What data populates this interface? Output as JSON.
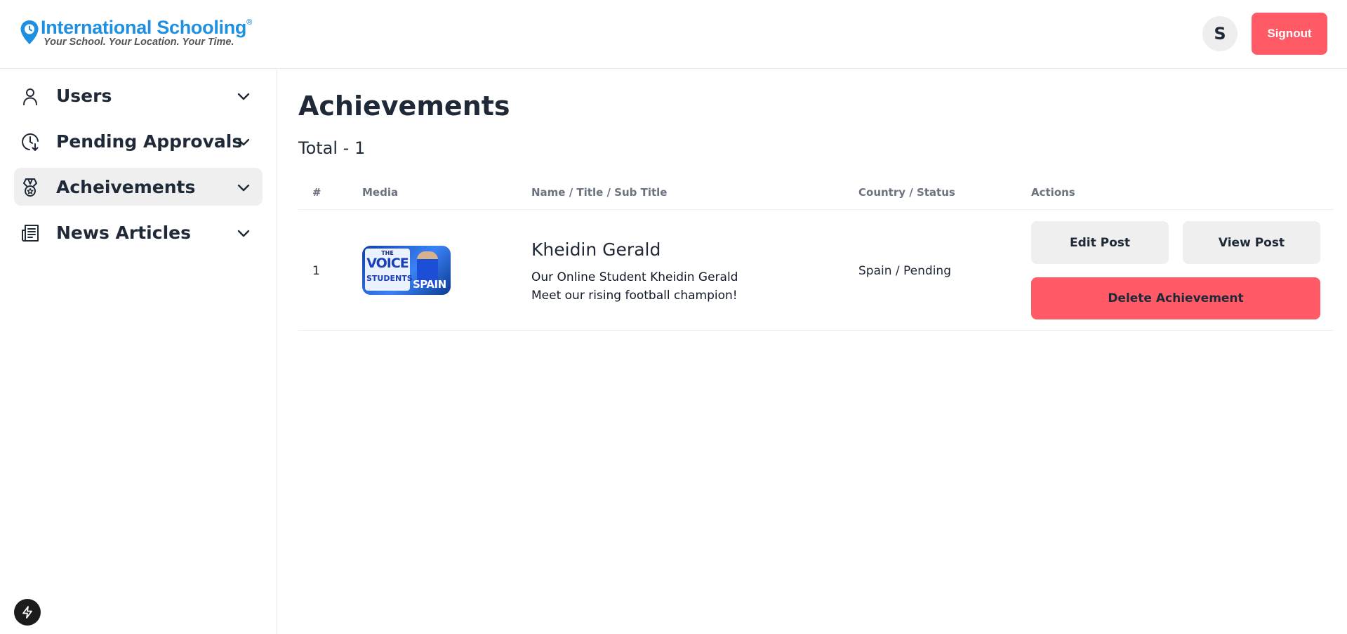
{
  "brand": {
    "name": "International Schooling",
    "registered": "®",
    "tagline": "Your School. Your Location. Your Time.",
    "color": "#1e8fe1"
  },
  "header": {
    "avatar_initial": "S",
    "signout_label": "Signout",
    "signout_color": "#ff5a66"
  },
  "sidebar": {
    "items": [
      {
        "label": "Users",
        "icon": "user-icon",
        "active": false
      },
      {
        "label": "Pending Approvals",
        "icon": "clock-download-icon",
        "active": false
      },
      {
        "label": "Acheivements",
        "icon": "medal-icon",
        "active": true
      },
      {
        "label": "News Articles",
        "icon": "newspaper-icon",
        "active": false
      }
    ],
    "footer_icon": "lightning-icon"
  },
  "main": {
    "title": "Achievements",
    "total": "Total - 1",
    "table": {
      "headers": [
        "#",
        "Media",
        "Name / Title / Sub Title",
        "Country / Status",
        "Actions"
      ],
      "rows": [
        {
          "index": "1",
          "media": {
            "line1": "THE",
            "line2": "VOICE",
            "line3": "STUDENTS",
            "country_text": "SPAIN"
          },
          "name": "Kheidin Gerald",
          "title": "Our Online Student Kheidin Gerald",
          "subtitle": "Meet our rising football champion!",
          "country_status": "Spain / Pending",
          "actions": {
            "edit": "Edit Post",
            "view": "View Post",
            "delete": "Delete Achievement"
          }
        }
      ]
    }
  }
}
